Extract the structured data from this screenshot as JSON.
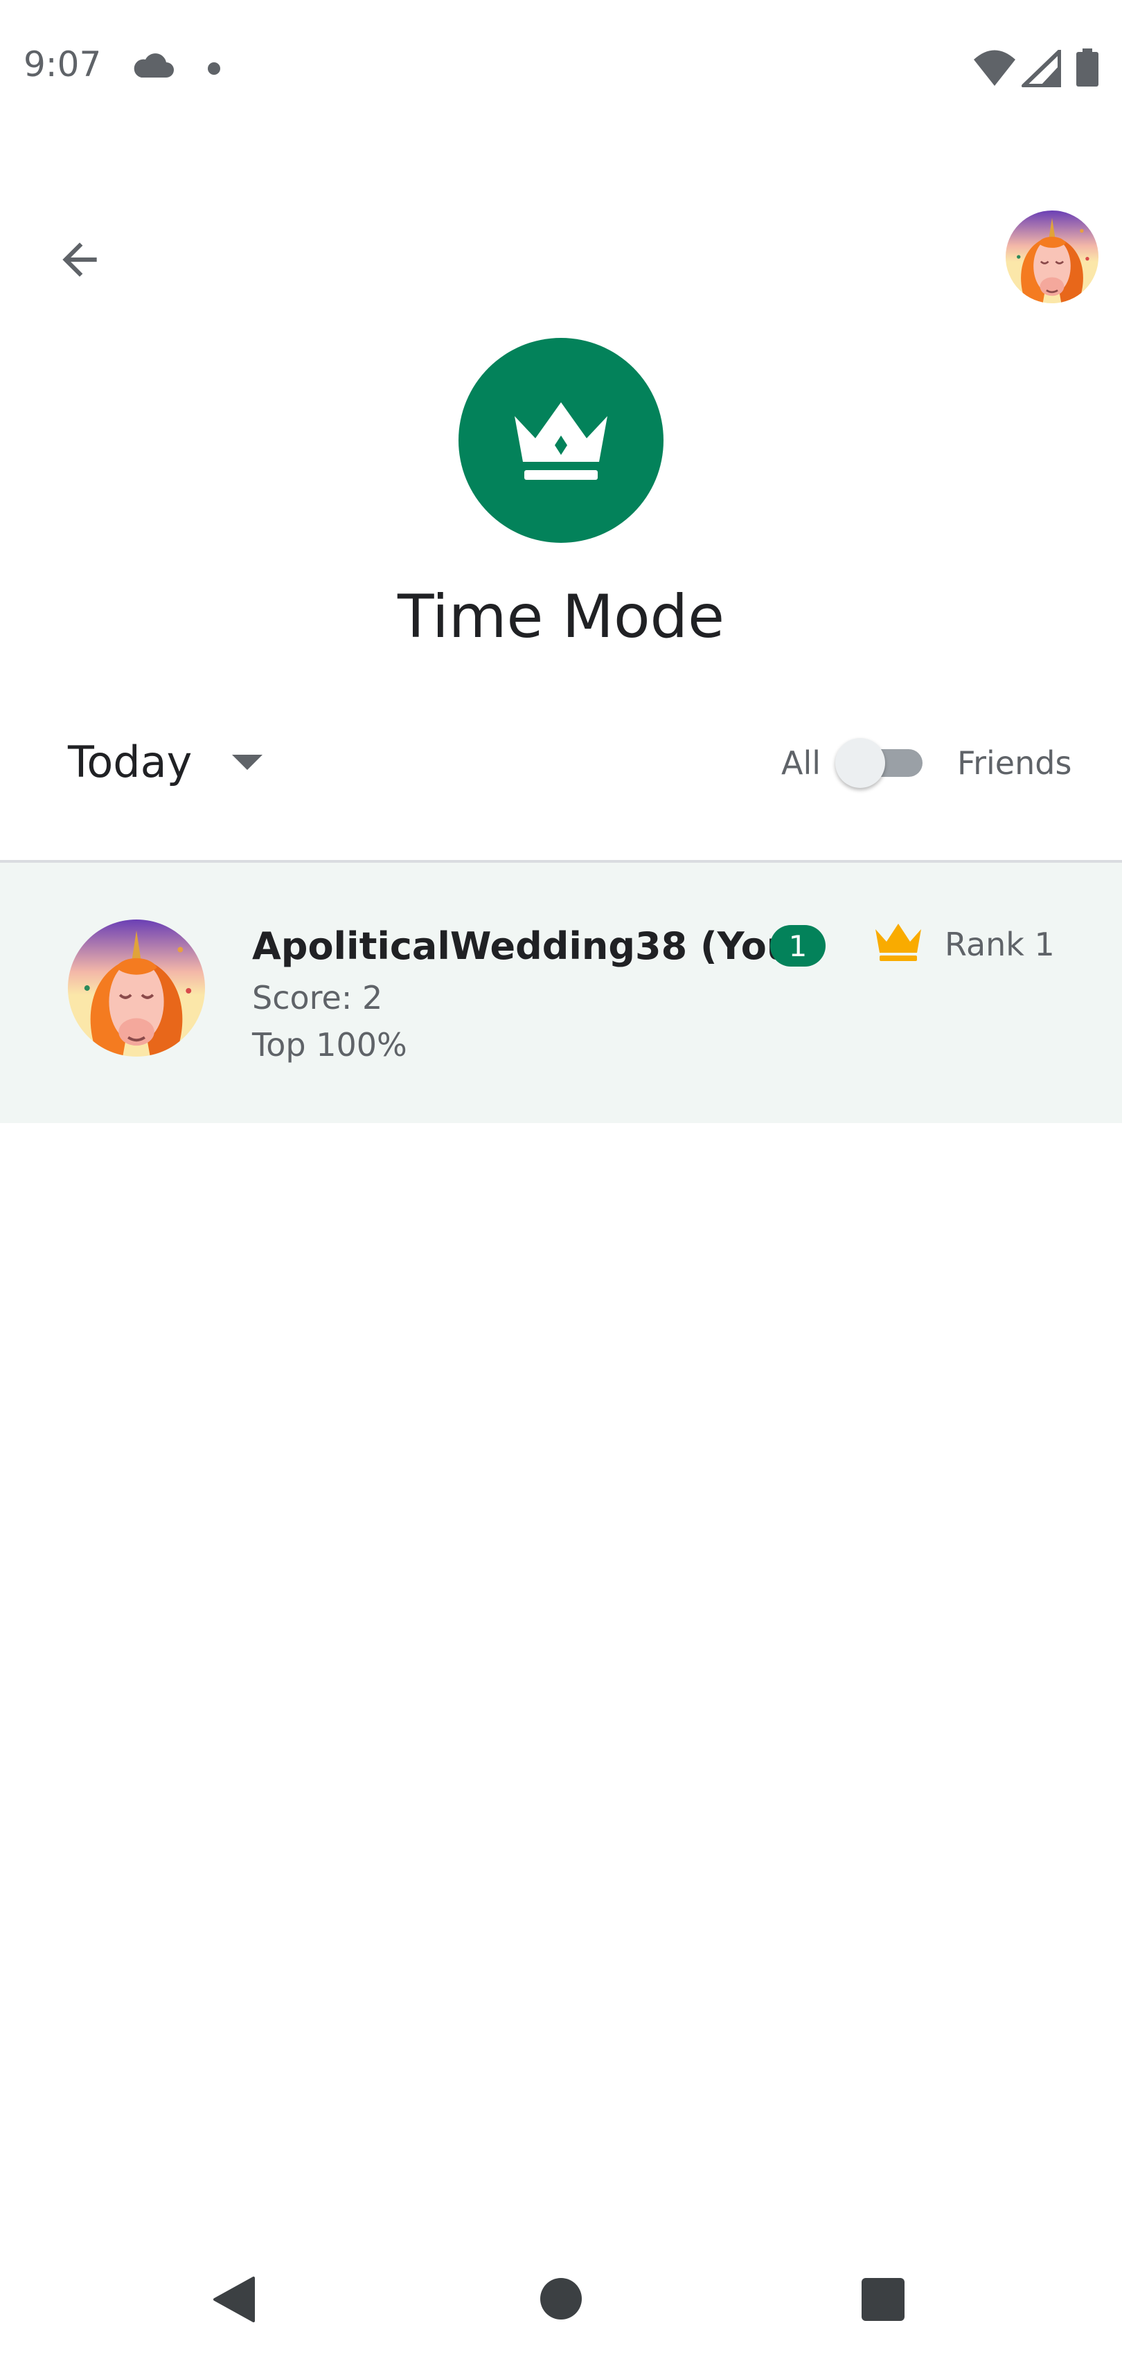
{
  "status_bar": {
    "time": "9:07",
    "icons": [
      "cloud-icon",
      "notification-dot-icon",
      "wifi-icon",
      "signal-icon",
      "battery-icon"
    ]
  },
  "app_bar": {
    "back_icon": "arrow-back-icon",
    "profile_icon": "unicorn-avatar"
  },
  "header": {
    "emblem_icon": "crown-icon",
    "emblem_color": "#03825a",
    "title": "Time Mode"
  },
  "filters": {
    "period": "Today",
    "toggle_left_label": "All",
    "toggle_right_label": "Friends",
    "friends_only": false
  },
  "leaderboard": {
    "rows": [
      {
        "name": "ApoliticalWedding38 (You)",
        "badge": "1",
        "rank_label": "Rank 1",
        "score": "Score: 2",
        "percentile": "Top 100%",
        "highlight_color": "#f1f6f4"
      }
    ]
  },
  "nav_bar": {
    "icons": [
      "nav-back-icon",
      "nav-home-icon",
      "nav-recents-icon"
    ]
  }
}
